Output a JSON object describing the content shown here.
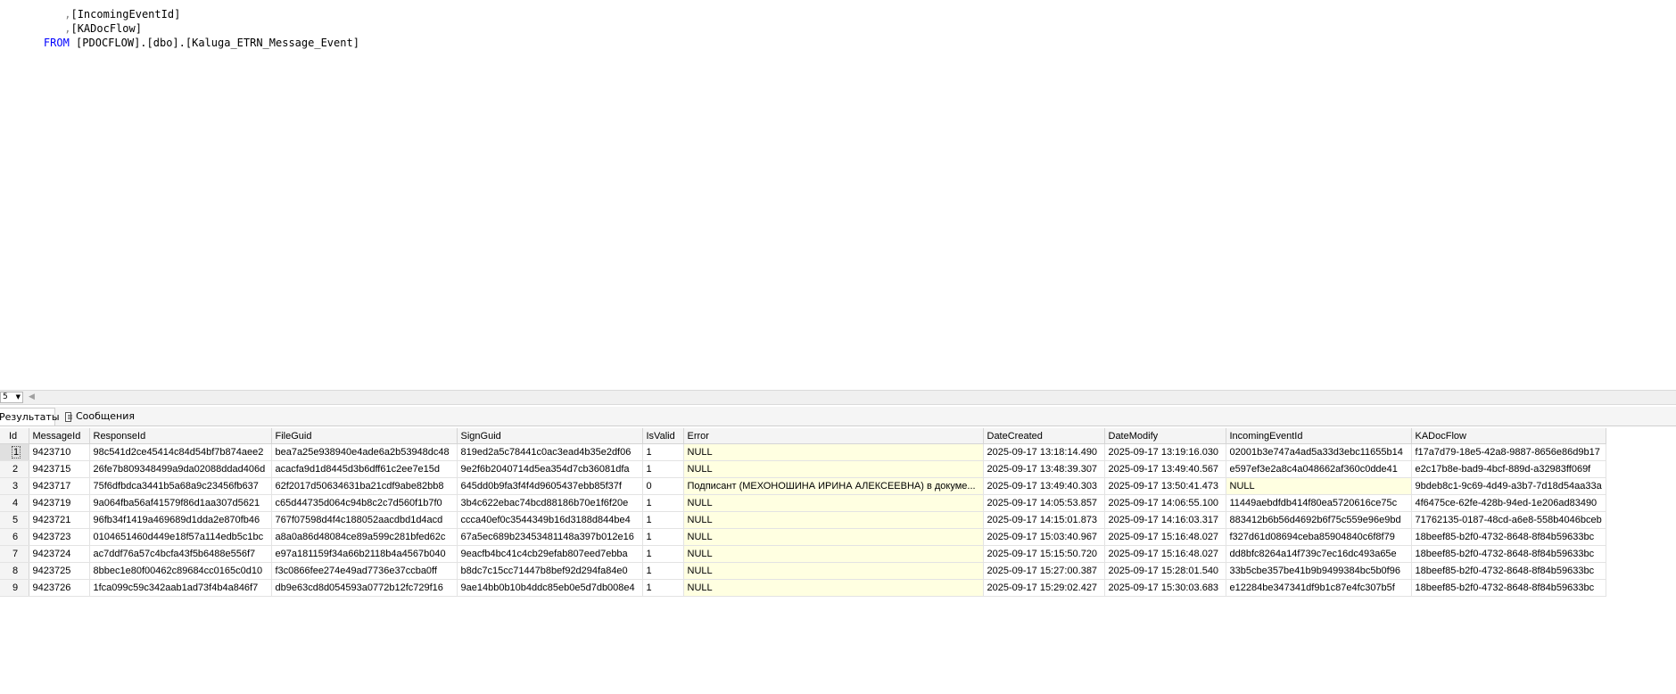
{
  "editor": {
    "lines": [
      {
        "prefix": "      ,",
        "ident": "[IncomingEventId]"
      },
      {
        "prefix": "      ,",
        "ident": "[KADocFlow]"
      },
      {
        "kw": "FROM",
        "ident": "[PDOCFLOW].[dbo].[Kaluga_ETRN_Message_Event]"
      }
    ]
  },
  "toolbar": {
    "zoom_value": "5"
  },
  "tabs": {
    "results": "Результаты",
    "messages": "Сообщения"
  },
  "grid": {
    "columns": [
      "Id",
      "MessageId",
      "ResponseId",
      "FileGuid",
      "SignGuid",
      "IsValid",
      "Error",
      "DateCreated",
      "DateModify",
      "IncomingEventId",
      "KADocFlow"
    ],
    "rows": [
      [
        "1",
        "9423710",
        "98c541d2ce45414c84d54bf7b874aee2",
        "bea7a25e938940e4ade6a2b53948dc48",
        "819ed2a5c78441c0ac3ead4b35e2df06",
        "1",
        "NULL",
        "2025-09-17 13:18:14.490",
        "2025-09-17 13:19:16.030",
        "02001b3e747a4ad5a33d3ebc11655b14",
        "f17a7d79-18e5-42a8-9887-8656e86d9b17"
      ],
      [
        "2",
        "9423715",
        "26fe7b809348499a9da02088ddad406d",
        "acacfa9d1d8445d3b6dff61c2ee7e15d",
        "9e2f6b2040714d5ea354d7cb36081dfa",
        "1",
        "NULL",
        "2025-09-17 13:48:39.307",
        "2025-09-17 13:49:40.567",
        "e597ef3e2a8c4a048662af360c0dde41",
        "e2c17b8e-bad9-4bcf-889d-a32983ff069f"
      ],
      [
        "3",
        "9423717",
        "75f6dfbdca3441b5a68a9c23456fb637",
        "62f2017d50634631ba21cdf9abe82bb8",
        "645dd0b9fa3f4f4d9605437ebb85f37f",
        "0",
        "Подписант (МЕХОНОШИНА ИРИНА АЛЕКСЕЕВНА) в докуме...",
        "2025-09-17 13:49:40.303",
        "2025-09-17 13:50:41.473",
        "NULL",
        "9bdeb8c1-9c69-4d49-a3b7-7d18d54aa33a"
      ],
      [
        "4",
        "9423719",
        "9a064fba56af41579f86d1aa307d5621",
        "c65d44735d064c94b8c2c7d560f1b7f0",
        "3b4c622ebac74bcd88186b70e1f6f20e",
        "1",
        "NULL",
        "2025-09-17 14:05:53.857",
        "2025-09-17 14:06:55.100",
        "11449aebdfdb414f80ea5720616ce75c",
        "4f6475ce-62fe-428b-94ed-1e206ad83490"
      ],
      [
        "5",
        "9423721",
        "96fb34f1419a469689d1dda2e870fb46",
        "767f07598d4f4c188052aacdbd1d4acd",
        "ccca40ef0c3544349b16d3188d844be4",
        "1",
        "NULL",
        "2025-09-17 14:15:01.873",
        "2025-09-17 14:16:03.317",
        "883412b6b56d4692b6f75c559e96e9bd",
        "71762135-0187-48cd-a6e8-558b4046bceb"
      ],
      [
        "6",
        "9423723",
        "0104651460d449e18f57a114edb5c1bc",
        "a8a0a86d48084ce89a599c281bfed62c",
        "67a5ec689b23453481148a397b012e16",
        "1",
        "NULL",
        "2025-09-17 15:03:40.967",
        "2025-09-17 15:16:48.027",
        "f327d61d08694ceba85904840c6f8f79",
        "18beef85-b2f0-4732-8648-8f84b59633bc"
      ],
      [
        "7",
        "9423724",
        "ac7ddf76a57c4bcfa43f5b6488e556f7",
        "e97a181159f34a66b2118b4a4567b040",
        "9eacfb4bc41c4cb29efab807eed7ebba",
        "1",
        "NULL",
        "2025-09-17 15:15:50.720",
        "2025-09-17 15:16:48.027",
        "dd8bfc8264a14f739c7ec16dc493a65e",
        "18beef85-b2f0-4732-8648-8f84b59633bc"
      ],
      [
        "8",
        "9423725",
        "8bbec1e80f00462c89684cc0165c0d10",
        "f3c0866fee274e49ad7736e37ccba0ff",
        "b8dc7c15cc71447b8bef92d294fa84e0",
        "1",
        "NULL",
        "2025-09-17 15:27:00.387",
        "2025-09-17 15:28:01.540",
        "33b5cbe357be41b9b9499384bc5b0f96",
        "18beef85-b2f0-4732-8648-8f84b59633bc"
      ],
      [
        "9",
        "9423726",
        "1fca099c59c342aab1ad73f4b4a846f7",
        "db9e63cd8d054593a0772b12fc729f16",
        "9ae14bb0b10b4ddc85eb0e5d7db008e4",
        "1",
        "NULL",
        "2025-09-17 15:29:02.427",
        "2025-09-17 15:30:03.683",
        "e12284be347341df9b1c87e4fc307b5f",
        "18beef85-b2f0-4732-8648-8f84b59633bc"
      ]
    ]
  }
}
